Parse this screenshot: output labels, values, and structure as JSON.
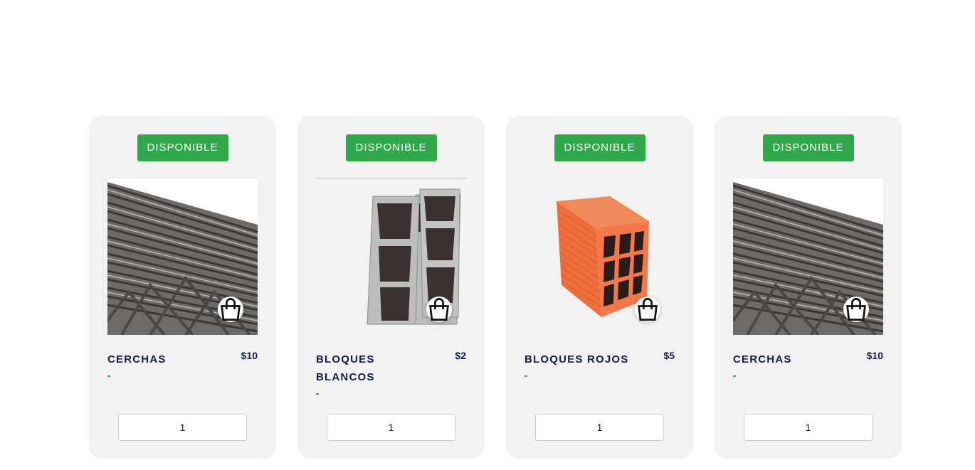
{
  "products": [
    {
      "badge": "DISPONIBLE",
      "title": "CERCHAS",
      "price": "$10",
      "quantity": "1",
      "image": "rebar-truss"
    },
    {
      "badge": "DISPONIBLE",
      "title": "BLOQUES BLANCOS",
      "price": "$2",
      "quantity": "1",
      "image": "white-concrete-blocks"
    },
    {
      "badge": "DISPONIBLE",
      "title": "BLOQUES ROJOS",
      "price": "$5",
      "quantity": "1",
      "image": "red-clay-block"
    },
    {
      "badge": "DISPONIBLE",
      "title": "CERCHAS",
      "price": "$10",
      "quantity": "1",
      "image": "rebar-truss"
    }
  ],
  "colors": {
    "badge": "#2ea84a",
    "title": "#141a4a",
    "card": "#f2f2f2"
  },
  "icons": {
    "cart": "shopping-bag-icon"
  }
}
